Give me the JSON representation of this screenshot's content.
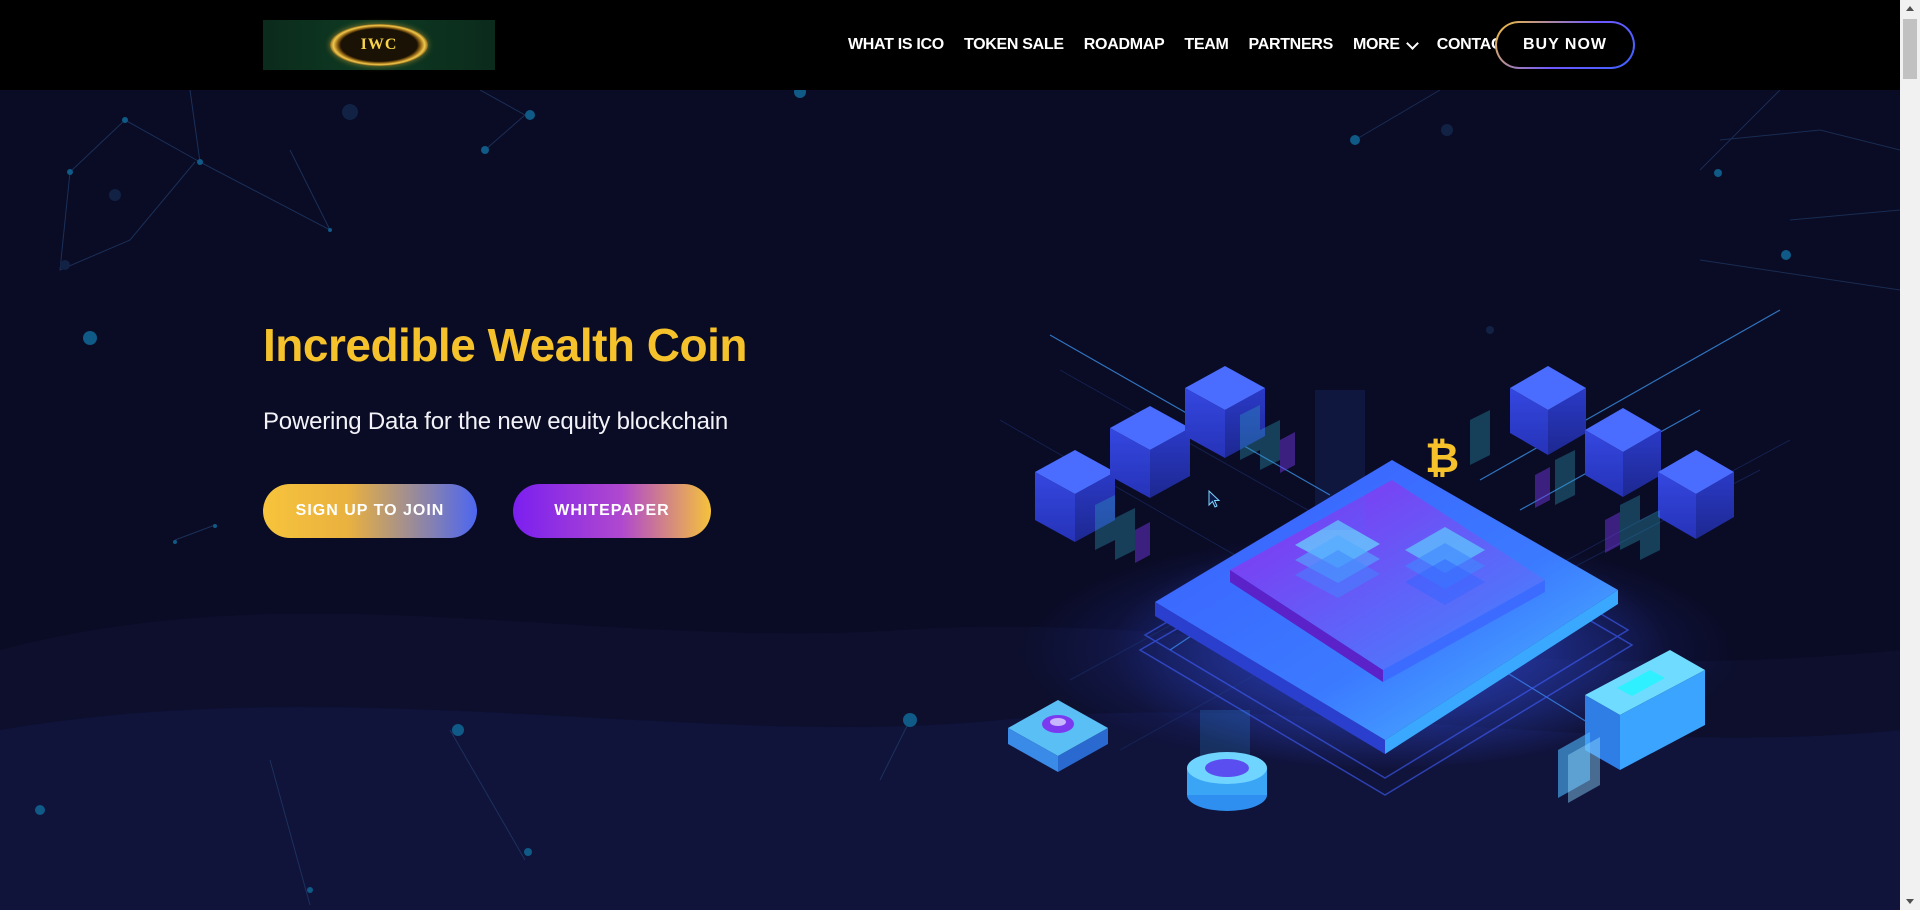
{
  "header": {
    "logo_text": "IWC",
    "nav": [
      {
        "label": "WHAT IS ICO"
      },
      {
        "label": "TOKEN SALE"
      },
      {
        "label": "ROADMAP"
      },
      {
        "label": "TEAM"
      },
      {
        "label": "PARTNERS"
      },
      {
        "label": "MORE",
        "has_dropdown": true
      },
      {
        "label": "CONTACT"
      }
    ],
    "buy_button": "BUY NOW"
  },
  "hero": {
    "title": "Incredible Wealth Coin",
    "subtitle": "Powering Data for the new equity blockchain",
    "primary_cta": "SIGN UP TO JOIN",
    "secondary_cta": "WHITEPAPER"
  },
  "colors": {
    "background": "#0a0b24",
    "header_background": "#000000",
    "title_yellow": "#f6c22c",
    "accent_blue": "#3c63ff",
    "accent_purple": "#7b1ff0"
  },
  "icons": [
    "chevron-down-icon",
    "bitcoin-icon",
    "mouse-cursor-icon"
  ]
}
